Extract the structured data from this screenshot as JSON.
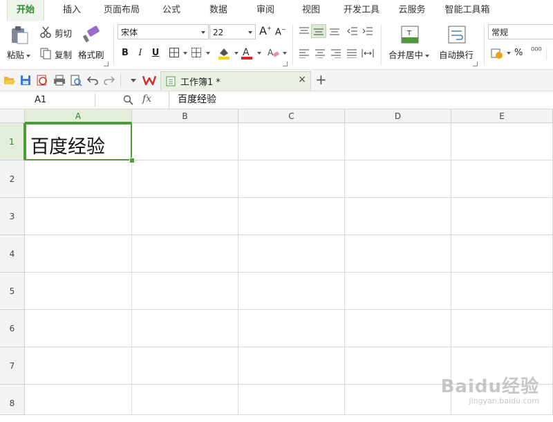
{
  "menu": {
    "tabs": [
      {
        "label": "开始",
        "active": true
      },
      {
        "label": "插入"
      },
      {
        "label": "页面布局"
      },
      {
        "label": "公式"
      },
      {
        "label": "数据"
      },
      {
        "label": "审阅"
      },
      {
        "label": "视图"
      },
      {
        "label": "开发工具"
      },
      {
        "label": "云服务"
      },
      {
        "label": "智能工具箱"
      }
    ]
  },
  "ribbon": {
    "paste_label": "粘贴",
    "cut_label": "剪切",
    "copy_label": "复制",
    "format_painter_label": "格式刷",
    "font_name": "宋体",
    "font_size": "22",
    "bold": "B",
    "italic": "I",
    "underline": "U",
    "merge_center_label": "合并居中",
    "wrap_text_label": "自动换行",
    "number_format": "常规",
    "percent": "%",
    "accent_color": "#2e8b2e",
    "fill_color": "#f5d800",
    "font_color": "#e02020"
  },
  "quick_access": {
    "icons": [
      "open-icon",
      "save-icon",
      "export-pdf-icon",
      "print-icon",
      "print-preview-icon",
      "undo-icon",
      "redo-icon",
      "customize-icon"
    ]
  },
  "document": {
    "tab_title": "工作簿1 *",
    "close": "×",
    "new_tab": "+"
  },
  "formula_bar": {
    "cell_reference": "A1",
    "fx": "fx",
    "content": "百度经验"
  },
  "sheet": {
    "columns": [
      "A",
      "B",
      "C",
      "D",
      "E"
    ],
    "rows": [
      "1",
      "2",
      "3",
      "4",
      "5",
      "6",
      "7",
      "8"
    ],
    "selected_cell": "A1",
    "cells": {
      "A1": "百度经验"
    },
    "selection_color": "#4c9c3a"
  },
  "watermark": {
    "main": "Baidu经验",
    "sub": "jingyan.baidu.com"
  }
}
